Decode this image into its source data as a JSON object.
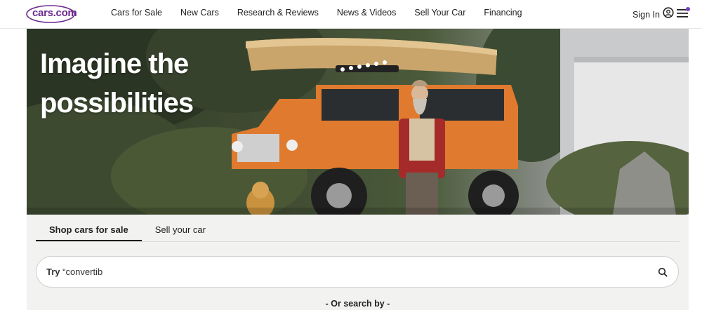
{
  "header": {
    "logo_text": "cars.com",
    "nav": [
      "Cars for Sale",
      "New Cars",
      "Research & Reviews",
      "News & Videos",
      "Sell Your Car",
      "Financing"
    ],
    "sign_in": "Sign In",
    "icons": {
      "account": "user-circle-icon",
      "menu": "hamburger-menu-icon"
    },
    "accent_color": "#6c2a8f"
  },
  "hero": {
    "title_line1": "Imagine the",
    "title_line2": "possibilities"
  },
  "search_panel": {
    "tabs": [
      {
        "label": "Shop cars for sale",
        "active": true
      },
      {
        "label": "Sell your car",
        "active": false
      }
    ],
    "search_prefix": "Try",
    "search_query": " “convertib",
    "search_icon": "search-icon",
    "or_search_by": "- Or search by -"
  }
}
